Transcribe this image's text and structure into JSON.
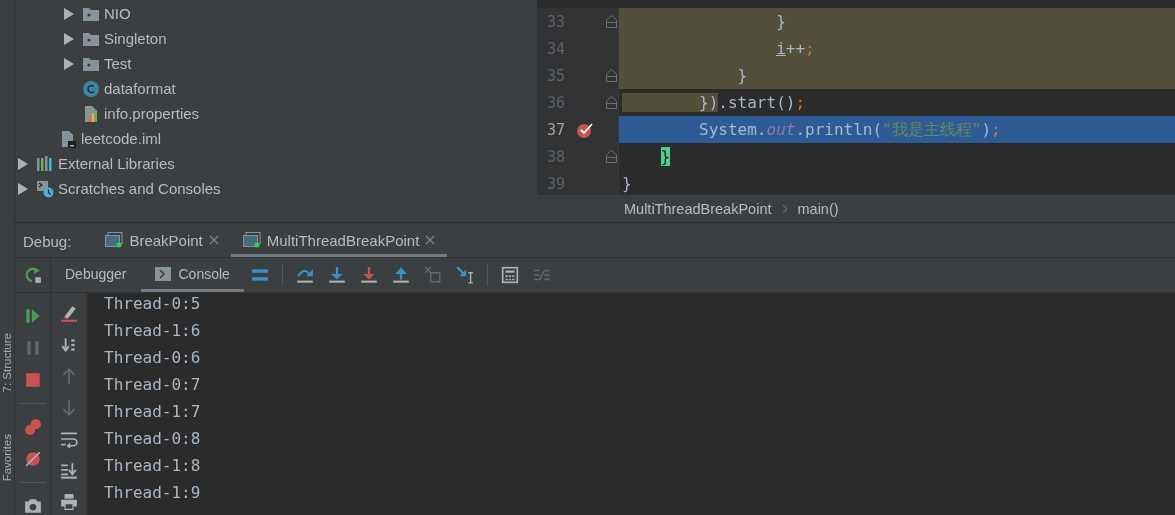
{
  "project_tree": [
    {
      "children": [
        {
          "children": [
            {
              "label": "NIO",
              "kind": "package",
              "expanded": false
            },
            {
              "label": "Singleton",
              "kind": "package",
              "expanded": false
            },
            {
              "label": "Test",
              "kind": "package",
              "expanded": false
            },
            {
              "label": "dataformat",
              "kind": "class"
            },
            {
              "label": "info.properties",
              "kind": "properties"
            }
          ]
        },
        {
          "label": "leetcode.iml",
          "kind": "module_file"
        }
      ]
    },
    {
      "label": "External Libraries",
      "kind": "libraries",
      "expanded": false
    },
    {
      "label": "Scratches and Consoles",
      "kind": "scratches",
      "expanded": false
    }
  ],
  "editor": {
    "lines": [
      {
        "number": "33",
        "scope": true,
        "current": false,
        "breakpoint": false,
        "fold": true,
        "tokens": [
          {
            "text": "                }",
            "kind": "plain"
          }
        ]
      },
      {
        "number": "34",
        "scope": true,
        "current": false,
        "breakpoint": false,
        "fold": false,
        "tokens": [
          {
            "text": "                i",
            "kind": "variable"
          },
          {
            "text": "++",
            "kind": "plain"
          },
          {
            "text": ";",
            "kind": "semicolon"
          }
        ]
      },
      {
        "number": "35",
        "scope": true,
        "current": false,
        "breakpoint": false,
        "fold": true,
        "tokens": [
          {
            "text": "            }",
            "kind": "plain"
          }
        ]
      },
      {
        "number": "36",
        "scope": false,
        "current": false,
        "breakpoint": false,
        "fold": true,
        "tokens": [
          {
            "text": "        })",
            "kind": "scope"
          },
          {
            "text": ".start()",
            "kind": "plain"
          },
          {
            "text": ";",
            "kind": "semicolon"
          }
        ]
      },
      {
        "number": "37",
        "scope": false,
        "current": true,
        "breakpoint": true,
        "fold": false,
        "tokens": [
          {
            "text": "        System.",
            "kind": "plain"
          },
          {
            "text": "out",
            "kind": "field"
          },
          {
            "text": ".println(",
            "kind": "plain"
          },
          {
            "text": "\"我是主线程\"",
            "kind": "string"
          },
          {
            "text": ")",
            "kind": "plain"
          },
          {
            "text": ";",
            "kind": "semicolon"
          }
        ]
      },
      {
        "number": "38",
        "scope": false,
        "current": false,
        "breakpoint": false,
        "fold": true,
        "tokens": [
          {
            "text": "    }",
            "kind": "brace_match"
          }
        ]
      },
      {
        "number": "39",
        "scope": false,
        "current": false,
        "breakpoint": false,
        "fold": false,
        "tokens": [
          {
            "text": "}",
            "kind": "plain"
          }
        ]
      }
    ],
    "breadcrumbs": [
      "MultiThreadBreakPoint",
      "main()"
    ]
  },
  "debug": {
    "label": "Debug:",
    "sessions": [
      {
        "name": "BreakPoint",
        "selected": false
      },
      {
        "name": "MultiThreadBreakPoint",
        "selected": true
      }
    ],
    "views": [
      {
        "label": "Debugger",
        "kind": "debugger",
        "selected": false
      },
      {
        "label": "Console",
        "kind": "console",
        "selected": true
      }
    ],
    "rerun": {
      "kind": "rerun",
      "disabled": false
    },
    "toolbar_groups": [
      [
        {
          "kind": "layout",
          "disabled": false
        }
      ],
      [
        {
          "kind": "step_over",
          "disabled": false
        },
        {
          "kind": "step_into",
          "disabled": false
        },
        {
          "kind": "force_step_into",
          "disabled": false
        },
        {
          "kind": "step_out",
          "disabled": false
        },
        {
          "kind": "drop_frame",
          "disabled": true
        },
        {
          "kind": "run_to_cursor",
          "disabled": false
        }
      ],
      [
        {
          "kind": "evaluate",
          "disabled": false
        },
        {
          "kind": "trace",
          "disabled": true
        }
      ]
    ],
    "action_groups": [
      [
        {
          "kind": "resume",
          "disabled": false
        },
        {
          "kind": "pause",
          "disabled": true
        },
        {
          "kind": "stop",
          "disabled": false
        }
      ],
      [
        {
          "kind": "view_breakpoints",
          "disabled": false
        },
        {
          "kind": "mute_breakpoints",
          "disabled": false
        }
      ],
      [
        {
          "kind": "camera",
          "disabled": false
        }
      ]
    ],
    "console_tools": [
      {
        "kind": "clear",
        "disabled": false
      },
      {
        "kind": "scroll_end",
        "disabled": false
      },
      {
        "kind": "up",
        "disabled": true
      },
      {
        "kind": "down",
        "disabled": true
      },
      {
        "kind": "soft_wrap",
        "disabled": false
      },
      {
        "kind": "scroll_to_end",
        "disabled": false
      },
      {
        "kind": "print",
        "disabled": false
      }
    ],
    "console_output": [
      "Thread-0:5",
      "Thread-1:6",
      "Thread-0:6",
      "Thread-0:7",
      "Thread-1:7",
      "Thread-0:8",
      "Thread-1:8",
      "Thread-1:9"
    ]
  },
  "side_tabs": [
    "7: Structure",
    "Favorites"
  ]
}
